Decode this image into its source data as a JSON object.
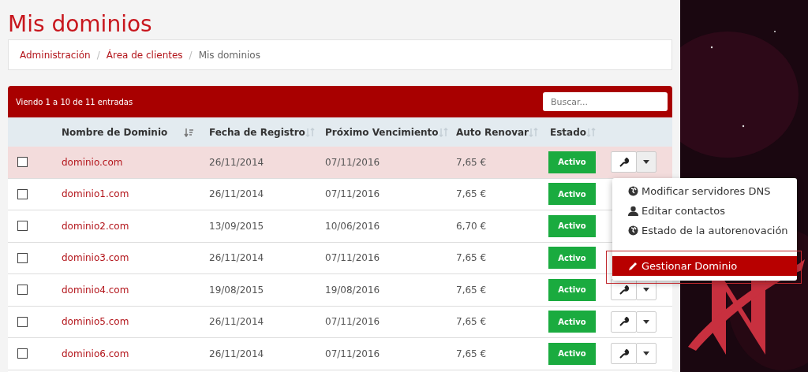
{
  "page_title": "Mis dominios",
  "breadcrumb": [
    {
      "label": "Administración",
      "link": true
    },
    {
      "separator": "/",
      "label": "Área de clientes",
      "link": true
    },
    {
      "separator": "/",
      "label": "Mis dominios",
      "link": false
    }
  ],
  "table": {
    "info": "Viendo 1 a 10 de 11 entradas",
    "search": {
      "placeholder": "Buscar..."
    },
    "columns": [
      {
        "label": "Nombre de Dominio",
        "sorted": true
      },
      {
        "label": "Fecha de Registro",
        "sorted": false
      },
      {
        "label": "Próximo Vencimiento",
        "sorted": false
      },
      {
        "label": "Auto Renovar",
        "sorted": false
      },
      {
        "label": "Estado",
        "sorted": false
      }
    ],
    "rows": [
      {
        "domain": "dominio.com",
        "registered": "26/11/2014",
        "expires": "07/11/2016",
        "renewal": "7,65 €",
        "status": "Activo",
        "selected": true,
        "checked": false,
        "actions": true
      },
      {
        "domain": "dominio1.com",
        "registered": "26/11/2014",
        "expires": "07/11/2016",
        "renewal": "7,65 €",
        "status": "Activo",
        "selected": false,
        "checked": false,
        "actions": false
      },
      {
        "domain": "dominio2.com",
        "registered": "13/09/2015",
        "expires": "10/06/2016",
        "renewal": "6,70 €",
        "status": "Activo",
        "selected": false,
        "checked": false,
        "actions": false
      },
      {
        "domain": "dominio3.com",
        "registered": "26/11/2014",
        "expires": "07/11/2016",
        "renewal": "7,65 €",
        "status": "Activo",
        "selected": false,
        "checked": false,
        "actions": false
      },
      {
        "domain": "dominio4.com",
        "registered": "19/08/2015",
        "expires": "19/08/2016",
        "renewal": "7,65 €",
        "status": "Activo",
        "selected": false,
        "checked": false,
        "actions": true
      },
      {
        "domain": "dominio5.com",
        "registered": "26/11/2014",
        "expires": "07/11/2016",
        "renewal": "7,65 €",
        "status": "Activo",
        "selected": false,
        "checked": false,
        "actions": true
      },
      {
        "domain": "dominio6.com",
        "registered": "26/11/2014",
        "expires": "07/11/2016",
        "renewal": "7,65 €",
        "status": "Activo",
        "selected": false,
        "checked": false,
        "actions": true
      }
    ]
  },
  "menu": {
    "items": [
      {
        "kind": "globe",
        "label": "Modificar servidores DNS",
        "selected": false
      },
      {
        "kind": "user",
        "label": "Editar contactos",
        "selected": false
      },
      {
        "kind": "globe",
        "label": "Estado de la autorenovación",
        "selected": false
      },
      {
        "kind": "pencil",
        "label": "Gestionar Dominio",
        "selected": true
      }
    ]
  }
}
